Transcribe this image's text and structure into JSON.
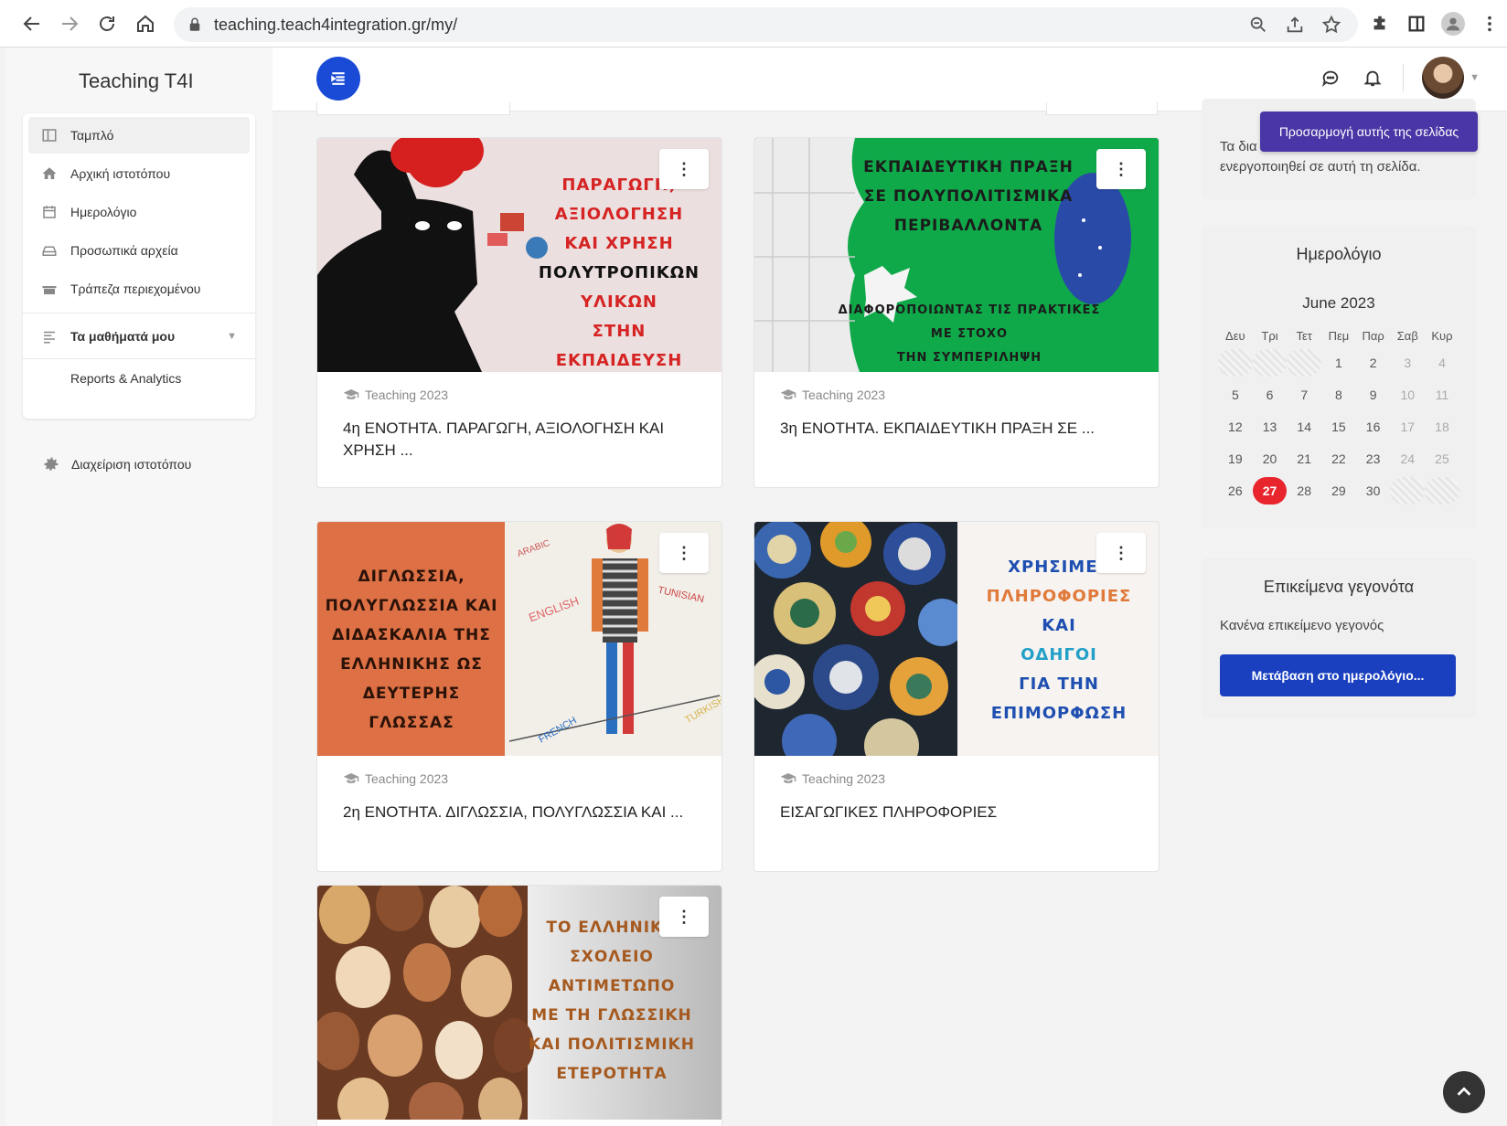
{
  "browser": {
    "url": "teaching.teach4integration.gr/my/"
  },
  "drawer": {
    "site_name": "Teaching T4I",
    "items": [
      {
        "label": "Ταμπλό",
        "icon": "dashboard-icon"
      },
      {
        "label": "Αρχική ιστοτόπου",
        "icon": "home-icon"
      },
      {
        "label": "Ημερολόγιο",
        "icon": "calendar-icon"
      },
      {
        "label": "Προσωπικά αρχεία",
        "icon": "files-icon"
      },
      {
        "label": "Τράπεζα περιεχομένου",
        "icon": "content-bank-icon"
      },
      {
        "label": "Τα μαθήματά μου",
        "icon": "courses-icon"
      },
      {
        "label": "Reports & Analytics"
      }
    ],
    "admin_label": "Διαχείριση ιστοτόπου"
  },
  "courses": [
    {
      "category": "Teaching 2023",
      "title": "4η ΕΝΟΤΗΤΑ. ΠΑΡΑΓΩΓΗ, ΑΞΙΟΛΟΓΗΣΗ ΚΑΙ ΧΡΗΣΗ ...",
      "poster": [
        "ΠΑΡΑΓΩΓΗ,",
        "ΑΞΙΟΛΟΓΗΣΗ",
        "ΚΑΙ ΧΡΗΣΗ",
        "ΠΟΛΥΤΡΟΠΙΚΩΝ",
        "ΥΛΙΚΩΝ",
        "ΣΤΗΝ ΕΚΠΑΙΔΕΥΣΗ"
      ]
    },
    {
      "category": "Teaching 2023",
      "title": "3η ΕΝΟΤΗΤΑ. ΕΚΠΑΙΔΕΥΤΙΚΗ ΠΡΑΞΗ ΣΕ ...",
      "poster": [
        "ΕΚΠΑΙΔΕΥΤΙΚΗ ΠΡΑΞΗ",
        "ΣΕ ΠΟΛΥΠΟΛΙΤΙΣΜΙΚΑ",
        "ΠΕΡΙΒΑΛΛΟΝΤΑ"
      ],
      "poster_sub": [
        "ΔΙΑΦΟΡΟΠΟΙΩΝΤΑΣ ΤΙΣ ΠΡΑΚΤΙΚΕΣ",
        "ΜΕ ΣΤΟΧΟ",
        "ΤΗΝ ΣΥΜΠΕΡΙΛΗΨΗ"
      ]
    },
    {
      "category": "Teaching 2023",
      "title": "2η ΕΝΟΤΗΤΑ. ΔΙΓΛΩΣΣΙΑ, ΠΟΛΥΓΛΩΣΣΙΑ ΚΑΙ ...",
      "poster": [
        "ΔΙΓΛΩΣΣΙΑ,",
        "ΠΟΛΥΓΛΩΣΣΙΑ ΚΑΙ",
        "ΔΙΔΑΣΚΑΛΙΑ ΤΗΣ",
        "ΕΛΛΗΝΙΚΗΣ ΩΣ",
        "ΔΕΥΤΕΡΗΣ ΓΛΩΣΣΑΣ"
      ],
      "poster_words": [
        "ARABIC",
        "ENGLISH",
        "TUNISIAN",
        "FRENCH",
        "TURKISH"
      ]
    },
    {
      "category": "Teaching 2023",
      "title": "ΕΙΣΑΓΩΓΙΚΕΣ ΠΛΗΡΟΦΟΡΙΕΣ",
      "poster": [
        "ΧΡΗΣΙΜΕΣ",
        "ΠΛΗΡΟΦΟΡΙΕΣ",
        "ΚΑΙ",
        "ΟΔΗΓΟΙ",
        "ΓΙΑ ΤΗΝ",
        "ΕΠΙΜΟΡΦΩΣΗ"
      ]
    },
    {
      "category": "",
      "title": "",
      "poster": [
        "ΤΟ ΕΛΛΗΝΙΚΟ",
        "ΣΧΟΛΕΙΟ",
        "ΑΝΤΙΜΕΤΩΠΟ",
        "ΜΕ ΤΗ ΓΛΩΣΣΙΚΗ",
        "ΚΑΙ ΠΟΛΙΤΙΣΜΙΚΗ",
        "ΕΤΕΡΟΤΗΤΑ"
      ]
    }
  ],
  "right": {
    "tip_text": "Τα δια… ενεργοποιηθεί σε αυτή τη σελίδα.",
    "tip_line1": "Τα δια",
    "tip_line2": "ενεργοποιηθεί σε αυτή τη σελίδα.",
    "customise_label": "Προσαρμογή αυτής της σελίδας",
    "calendar_title": "Ημερολόγιο",
    "month": "June 2023",
    "weekdays": [
      "Δευ",
      "Τρι",
      "Τετ",
      "Πεμ",
      "Παρ",
      "Σαβ",
      "Κυρ"
    ],
    "weeks": [
      [
        "",
        "",
        "",
        "1",
        "2",
        "3",
        "4"
      ],
      [
        "5",
        "6",
        "7",
        "8",
        "9",
        "10",
        "11"
      ],
      [
        "12",
        "13",
        "14",
        "15",
        "16",
        "17",
        "18"
      ],
      [
        "19",
        "20",
        "21",
        "22",
        "23",
        "24",
        "25"
      ],
      [
        "26",
        "27",
        "28",
        "29",
        "30",
        "",
        ""
      ]
    ],
    "today": "27",
    "events_title": "Επικείμενα γεγονότα",
    "events_empty": "Κανένα επικείμενο γεγονός",
    "goto_label": "Μετάβαση στο ημερολόγιο..."
  },
  "colors": {
    "primary": "#1a4bd6",
    "today": "#e8242c",
    "customise": "#4a36a6"
  }
}
